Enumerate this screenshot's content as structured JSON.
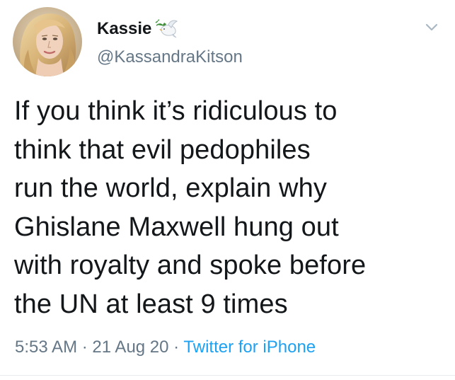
{
  "tweet": {
    "author": {
      "display_name": "Kassie",
      "handle": "@KassandraKitson",
      "avatar_icon": "profile-photo",
      "badge_icon": "dove-with-olive-branch-icon"
    },
    "text": "If you think it’s ridiculous to\nthink that evil pedophiles\nrun the world, explain why\nGhislane Maxwell hung out\nwith royalty and spoke before\nthe UN at least 9 times",
    "time": "5:53 AM",
    "separator": " · ",
    "date": "21 Aug 20",
    "source": "Twitter for iPhone",
    "menu_icon": "chevron-down-icon"
  },
  "colors": {
    "text_primary": "#14171a",
    "text_secondary": "#657786",
    "link": "#1da1f2",
    "background": "#ffffff"
  }
}
